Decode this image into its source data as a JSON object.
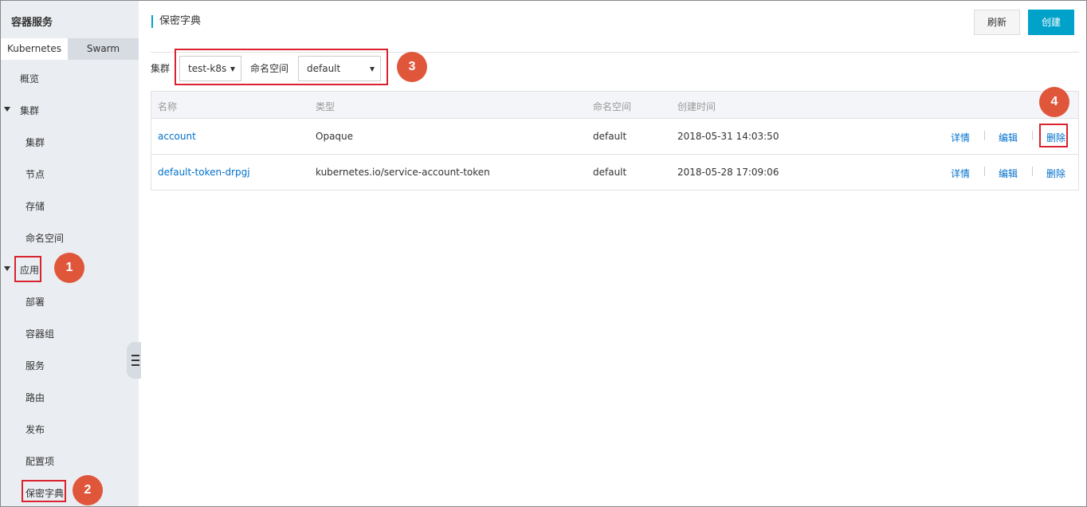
{
  "sidebar": {
    "title": "容器服务",
    "tabs": [
      {
        "label": "Kubernetes",
        "active": true
      },
      {
        "label": "Swarm",
        "active": false
      }
    ],
    "overview": "概览",
    "groups": [
      {
        "label": "集群",
        "items": [
          "集群",
          "节点",
          "存储",
          "命名空间"
        ]
      },
      {
        "label": "应用",
        "items": [
          "部署",
          "容器组",
          "服务",
          "路由",
          "发布",
          "配置项",
          "保密字典"
        ]
      }
    ]
  },
  "header": {
    "title": "保密字典",
    "refresh_label": "刷新",
    "create_label": "创建"
  },
  "filters": {
    "cluster_label": "集群",
    "cluster_value": "test-k8s",
    "namespace_label": "命名空间",
    "namespace_value": "default"
  },
  "table": {
    "columns": [
      "名称",
      "类型",
      "命名空间",
      "创建时间"
    ],
    "rows": [
      {
        "name": "account",
        "type": "Opaque",
        "namespace": "default",
        "created": "2018-05-31 14:03:50",
        "actions": [
          "详情",
          "编辑",
          "删除"
        ]
      },
      {
        "name": "default-token-drpgj",
        "type": "kubernetes.io/service-account-token",
        "namespace": "default",
        "created": "2018-05-28 17:09:06",
        "actions": [
          "详情",
          "编辑",
          "删除"
        ]
      }
    ]
  },
  "annotations": {
    "badges": [
      "1",
      "2",
      "3",
      "4"
    ],
    "color": "#e0563b"
  },
  "colors": {
    "accent": "#00a2ca",
    "link": "#0070cc",
    "sidebar_bg": "#eaedf1",
    "highlight": "#d9232e"
  }
}
